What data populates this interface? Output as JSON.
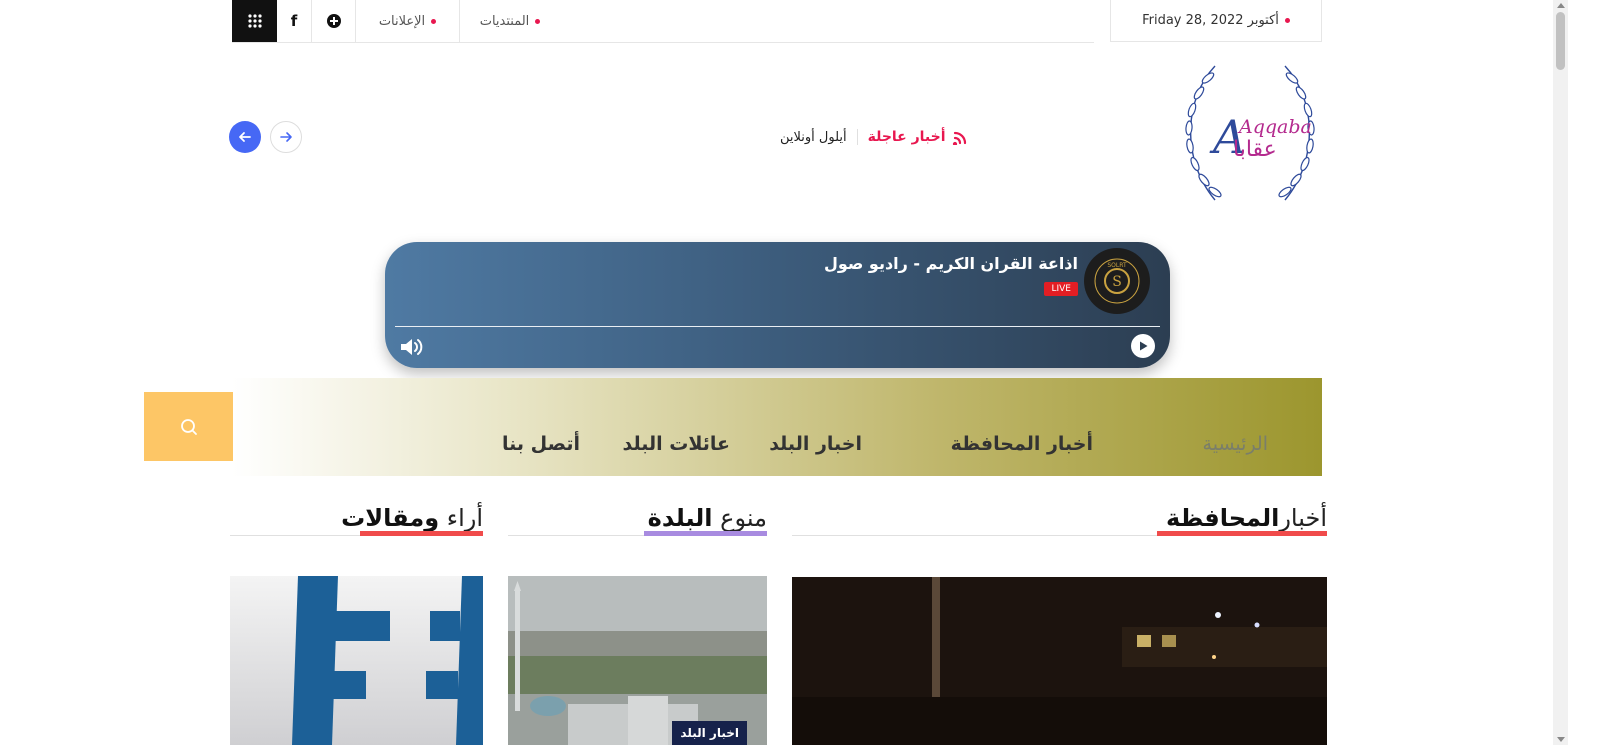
{
  "topbar": {
    "date": "Friday 28, أكتوبر 2022",
    "links": [
      {
        "label": "المنتديات"
      },
      {
        "label": "الإعلانات"
      }
    ],
    "social": [
      {
        "name": "facebook-icon",
        "label": "f"
      },
      {
        "name": "tiktok-icon"
      }
    ]
  },
  "breaking": {
    "label": "أخبار عاجلة",
    "headline": "أيلول أونلاين"
  },
  "logo": {
    "latin": "Aqqaba",
    "arabic": "عقابا"
  },
  "radio": {
    "title": "اذاعة القران الكريم - راديو صول",
    "live": "LIVE",
    "badge_text": "SOLRT"
  },
  "menu": {
    "items": [
      {
        "label": "الرئيسية",
        "active": true
      },
      {
        "label": "أخبار المحافظة"
      },
      {
        "label": "اخبار البلد"
      },
      {
        "label": "عائلات البلد"
      },
      {
        "label": "أتصل بنا"
      }
    ]
  },
  "sections": {
    "governorate": {
      "light": "أخبار",
      "bold": "المحافظة"
    },
    "town": {
      "light": "منوع",
      "bold": "البلدة"
    },
    "opinions": {
      "light": "أراء",
      "bold": "ومقالات"
    }
  },
  "cards": {
    "town_tag": "اخبار البلد"
  },
  "colors": {
    "accent_red": "#e8174f",
    "nav_blue": "#4668f5",
    "search_yellow": "#fdc666",
    "underline_red": "#f04b4b",
    "underline_purple": "#a88be0"
  }
}
